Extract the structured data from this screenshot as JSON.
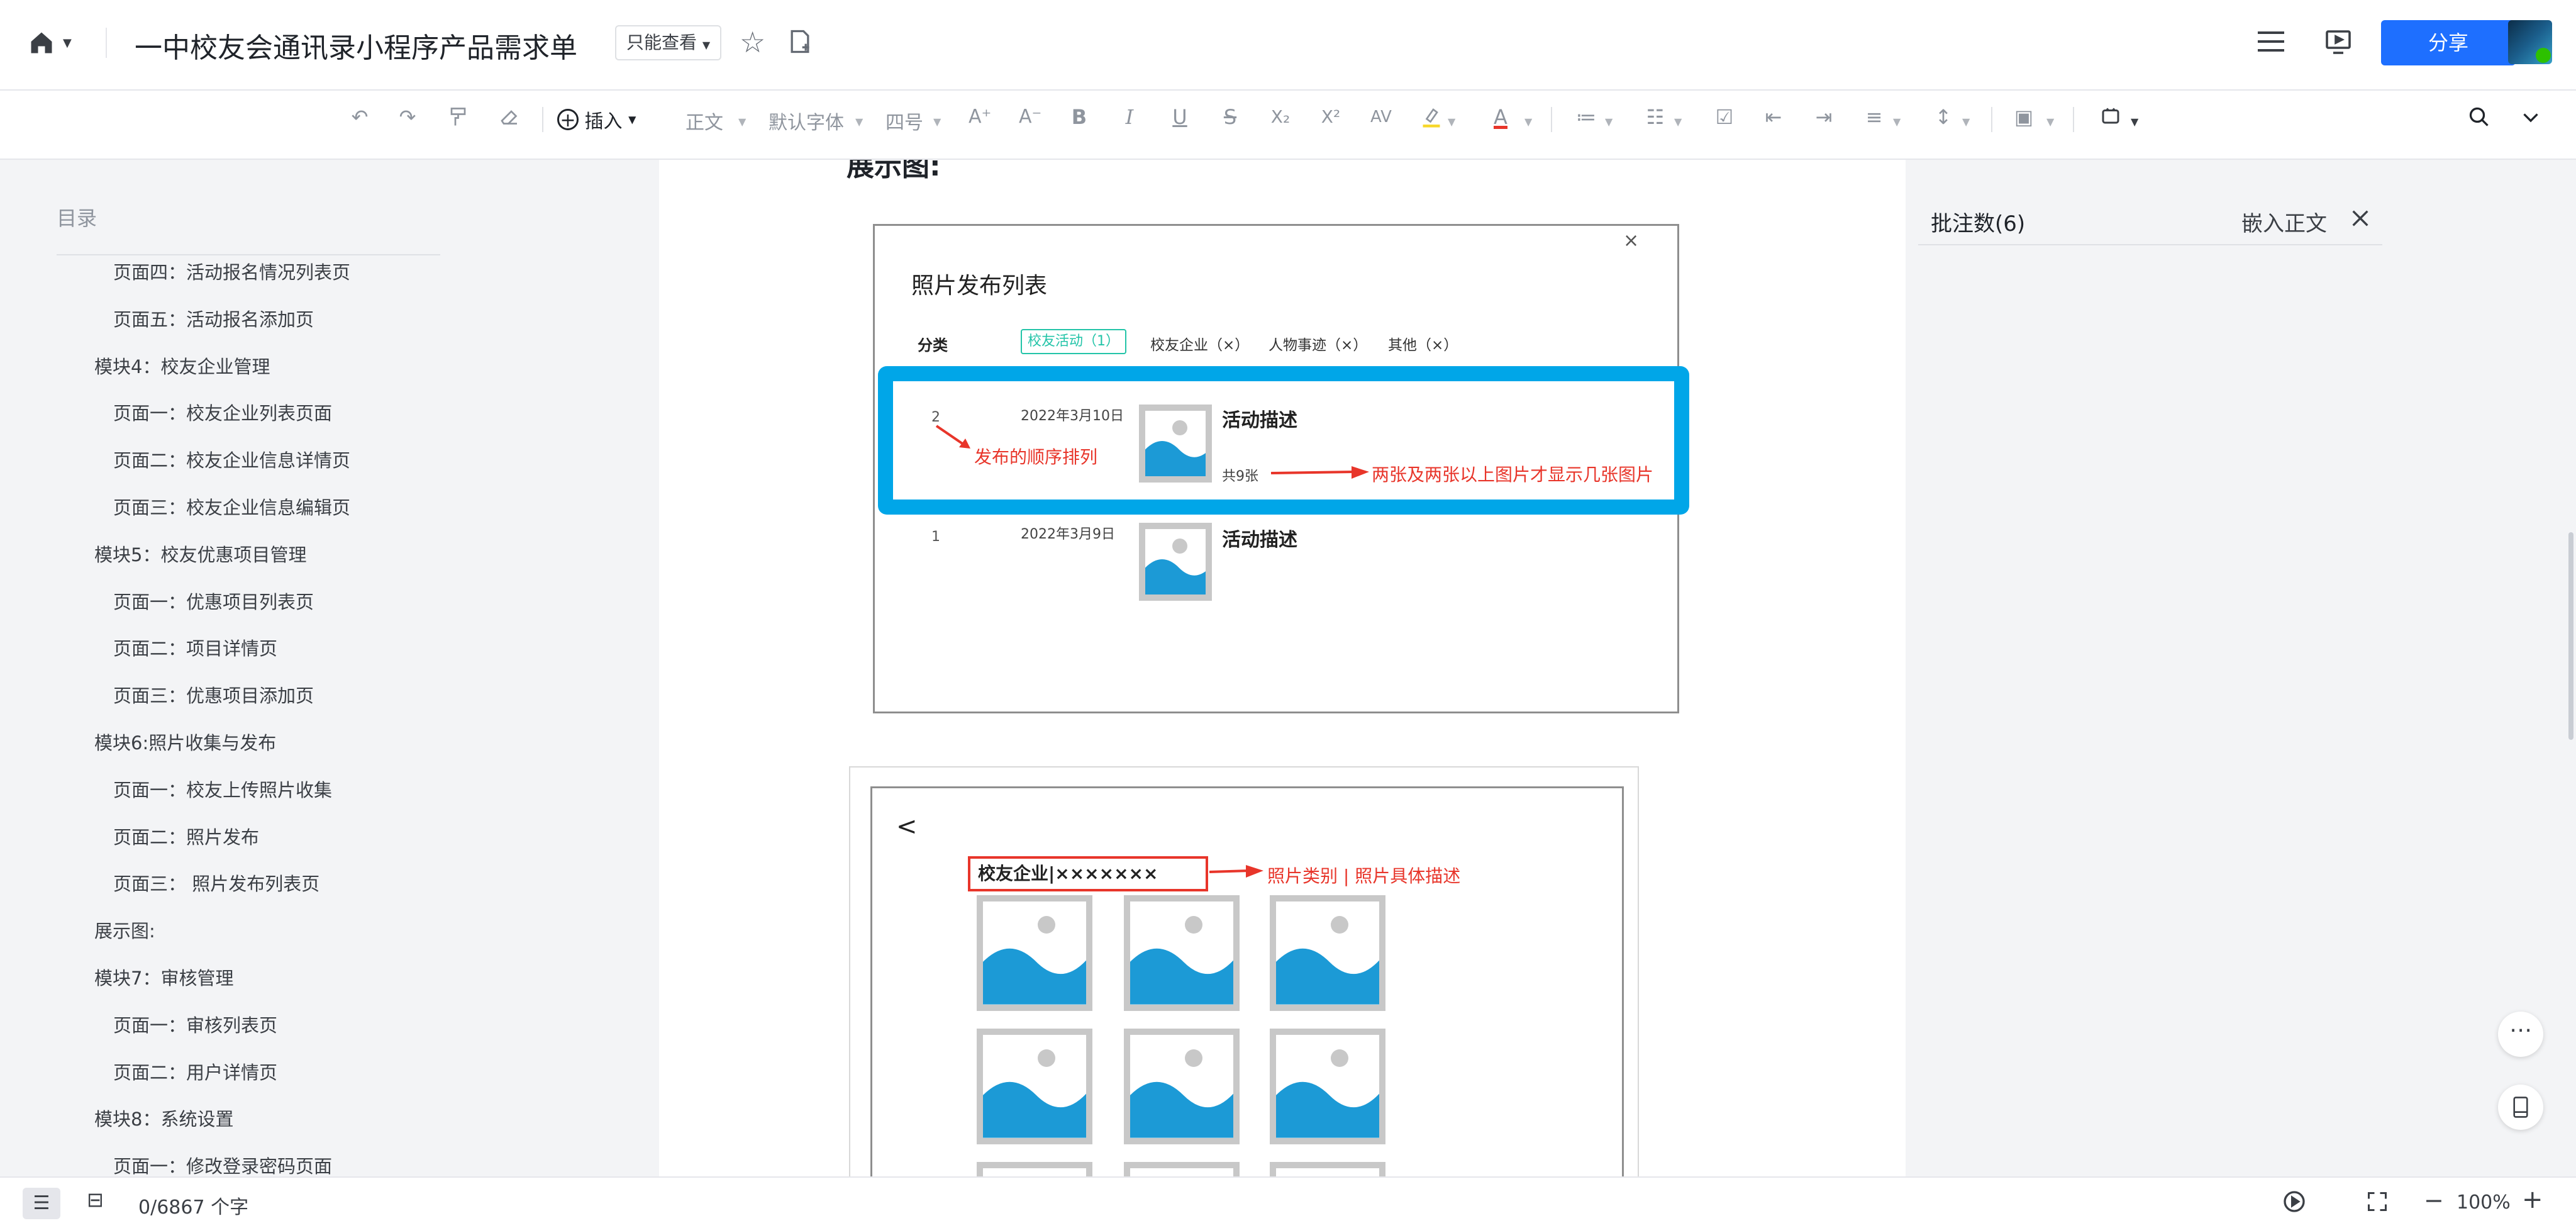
{
  "titlebar": {
    "doc_title": "一中校友会通讯录小程序产品需求单",
    "mode_label": "只能查看",
    "share_label": "分享"
  },
  "toolbar": {
    "insert_label": "插入",
    "style_label": "正文",
    "font_label": "默认字体",
    "size_label": "四号"
  },
  "sidebar": {
    "heading": "目录",
    "items": [
      {
        "label": "页面四：活动报名情况列表页",
        "level": 2
      },
      {
        "label": "页面五：活动报名添加页",
        "level": 2
      },
      {
        "label": "模块4：校友企业管理",
        "level": 1
      },
      {
        "label": "页面一：校友企业列表页面",
        "level": 2
      },
      {
        "label": "页面二：校友企业信息详情页",
        "level": 2
      },
      {
        "label": "页面三：校友企业信息编辑页",
        "level": 2
      },
      {
        "label": "模块5：校友优惠项目管理",
        "level": 1
      },
      {
        "label": "页面一：优惠项目列表页",
        "level": 2
      },
      {
        "label": "页面二：项目详情页",
        "level": 2
      },
      {
        "label": "页面三：优惠项目添加页",
        "level": 2
      },
      {
        "label": "模块6:照片收集与发布",
        "level": 1
      },
      {
        "label": "页面一：校友上传照片收集",
        "level": 2
      },
      {
        "label": "页面二：照片发布",
        "level": 2
      },
      {
        "label": "页面三： 照片发布列表页",
        "level": 2
      },
      {
        "label": "展示图:",
        "level": 1
      },
      {
        "label": "模块7：审核管理",
        "level": 1
      },
      {
        "label": "页面一：审核列表页",
        "level": 2
      },
      {
        "label": "页面二：用户详情页",
        "level": 2
      },
      {
        "label": "模块8：系统设置",
        "level": 1
      },
      {
        "label": "页面一：修改登录密码页面",
        "level": 2
      }
    ]
  },
  "document": {
    "section_heading": "展示图:",
    "mockup1": {
      "title": "照片发布列表",
      "close_glyph": "×",
      "category_label": "分类",
      "tabs": [
        "校友活动（1）",
        "校友企业（×）",
        "人物事迹（×）",
        "其他（×）"
      ],
      "rows": [
        {
          "index": "2",
          "date": "2022年3月10日",
          "title": "活动描述",
          "count": "共9张"
        },
        {
          "index": "1",
          "date": "2022年3月9日",
          "title": "活动描述",
          "count": ""
        }
      ],
      "annotation_order": "发布的顺序排列",
      "annotation_count": "两张及两张以上图片才显示几张图片"
    },
    "mockup2": {
      "back_glyph": "<",
      "header_text": "校友企业|×××××××",
      "annotation": "照片类别 | 照片具体描述"
    }
  },
  "comments": {
    "title": "批注数(6)",
    "embed_label": "嵌入正文"
  },
  "statusbar": {
    "word_count": "0/6867 个字",
    "zoom": "100%"
  },
  "colors": {
    "primary": "#1e6fff",
    "highlight_frame": "#00a6e8",
    "annotation_red": "#e8352a",
    "placeholder_blue": "#1c9ad6",
    "tab_active_green": "#23c4a8"
  }
}
